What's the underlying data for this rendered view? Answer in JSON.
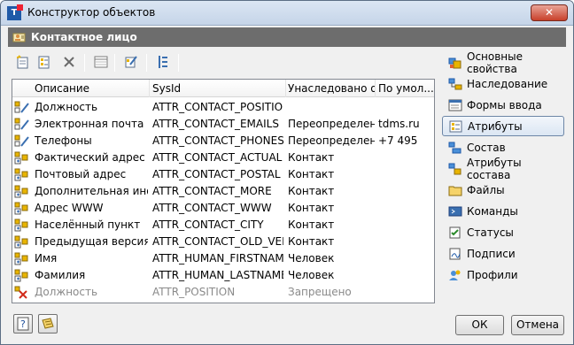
{
  "window": {
    "title": "Конструктор объектов",
    "close_label": "✕"
  },
  "header": {
    "title": "Контактное лицо"
  },
  "table": {
    "columns": [
      "Описание",
      "SysId",
      "Унаследовано от",
      "По умол..."
    ],
    "rows": [
      {
        "desc": "Должность",
        "sysid": "ATTR_CONTACT_POSITION",
        "inherited": "",
        "default": "",
        "icon": "attribute-edit-icon",
        "disabled": false
      },
      {
        "desc": "Электронная почта",
        "sysid": "ATTR_CONTACT_EMAILS",
        "inherited": "Переопределено",
        "default": "tdms.ru",
        "icon": "attribute-edit-icon",
        "disabled": false
      },
      {
        "desc": "Телефоны",
        "sysid": "ATTR_CONTACT_PHONES",
        "inherited": "Переопределено",
        "default": "+7 495",
        "icon": "attribute-edit-icon",
        "disabled": false
      },
      {
        "desc": "Фактический адрес",
        "sysid": "ATTR_CONTACT_ACTUAL",
        "inherited": "Контакт",
        "default": "",
        "icon": "attribute-inherited-icon",
        "disabled": false
      },
      {
        "desc": "Почтовый адрес",
        "sysid": "ATTR_CONTACT_POSTAL",
        "inherited": "Контакт",
        "default": "",
        "icon": "attribute-inherited-icon",
        "disabled": false
      },
      {
        "desc": "Дополнительная инфо",
        "sysid": "ATTR_CONTACT_MORE",
        "inherited": "Контакт",
        "default": "",
        "icon": "attribute-inherited-icon",
        "disabled": false
      },
      {
        "desc": "Адрес WWW",
        "sysid": "ATTR_CONTACT_WWW",
        "inherited": "Контакт",
        "default": "",
        "icon": "attribute-inherited-icon",
        "disabled": false
      },
      {
        "desc": "Населённый пункт",
        "sysid": "ATTR_CONTACT_CITY",
        "inherited": "Контакт",
        "default": "",
        "icon": "attribute-inherited-icon",
        "disabled": false
      },
      {
        "desc": "Предыдущая версия",
        "sysid": "ATTR_CONTACT_OLD_VERS",
        "inherited": "Контакт",
        "default": "",
        "icon": "attribute-inherited-icon",
        "disabled": false
      },
      {
        "desc": "Имя",
        "sysid": "ATTR_HUMAN_FIRSTNAME",
        "inherited": "Человек",
        "default": "",
        "icon": "attribute-inherited-icon",
        "disabled": false
      },
      {
        "desc": "Фамилия",
        "sysid": "ATTR_HUMAN_LASTNAME",
        "inherited": "Человек",
        "default": "",
        "icon": "attribute-inherited-icon",
        "disabled": false
      },
      {
        "desc": "Должность",
        "sysid": "ATTR_POSITION",
        "inherited": "Запрещено",
        "default": "",
        "icon": "attribute-forbidden-icon",
        "disabled": true
      }
    ]
  },
  "sidebar": {
    "items": [
      {
        "label": "Основные свойства",
        "name": "sidebar-item-main-properties",
        "icon": "properties-icon"
      },
      {
        "label": "Наследование",
        "name": "sidebar-item-inheritance",
        "icon": "inheritance-icon"
      },
      {
        "label": "Формы ввода",
        "name": "sidebar-item-input-forms",
        "icon": "form-icon"
      },
      {
        "label": "Атрибуты",
        "name": "sidebar-item-attributes",
        "icon": "attributes-icon",
        "active": true
      },
      {
        "label": "Состав",
        "name": "sidebar-item-composition",
        "icon": "composition-icon"
      },
      {
        "label": "Атрибуты состава",
        "name": "sidebar-item-composition-attributes",
        "icon": "composition-attributes-icon"
      },
      {
        "label": "Файлы",
        "name": "sidebar-item-files",
        "icon": "files-icon"
      },
      {
        "label": "Команды",
        "name": "sidebar-item-commands",
        "icon": "commands-icon"
      },
      {
        "label": "Статусы",
        "name": "sidebar-item-statuses",
        "icon": "statuses-icon"
      },
      {
        "label": "Подписи",
        "name": "sidebar-item-signatures",
        "icon": "signatures-icon"
      },
      {
        "label": "Профили",
        "name": "sidebar-item-profiles",
        "icon": "profiles-icon"
      }
    ]
  },
  "buttons": {
    "ok": "ОК",
    "cancel": "Отмена"
  },
  "colors": {
    "header_bg": "#6d6d6d",
    "accent": "#1f5aa8",
    "disabled_text": "#8a8a8a"
  }
}
